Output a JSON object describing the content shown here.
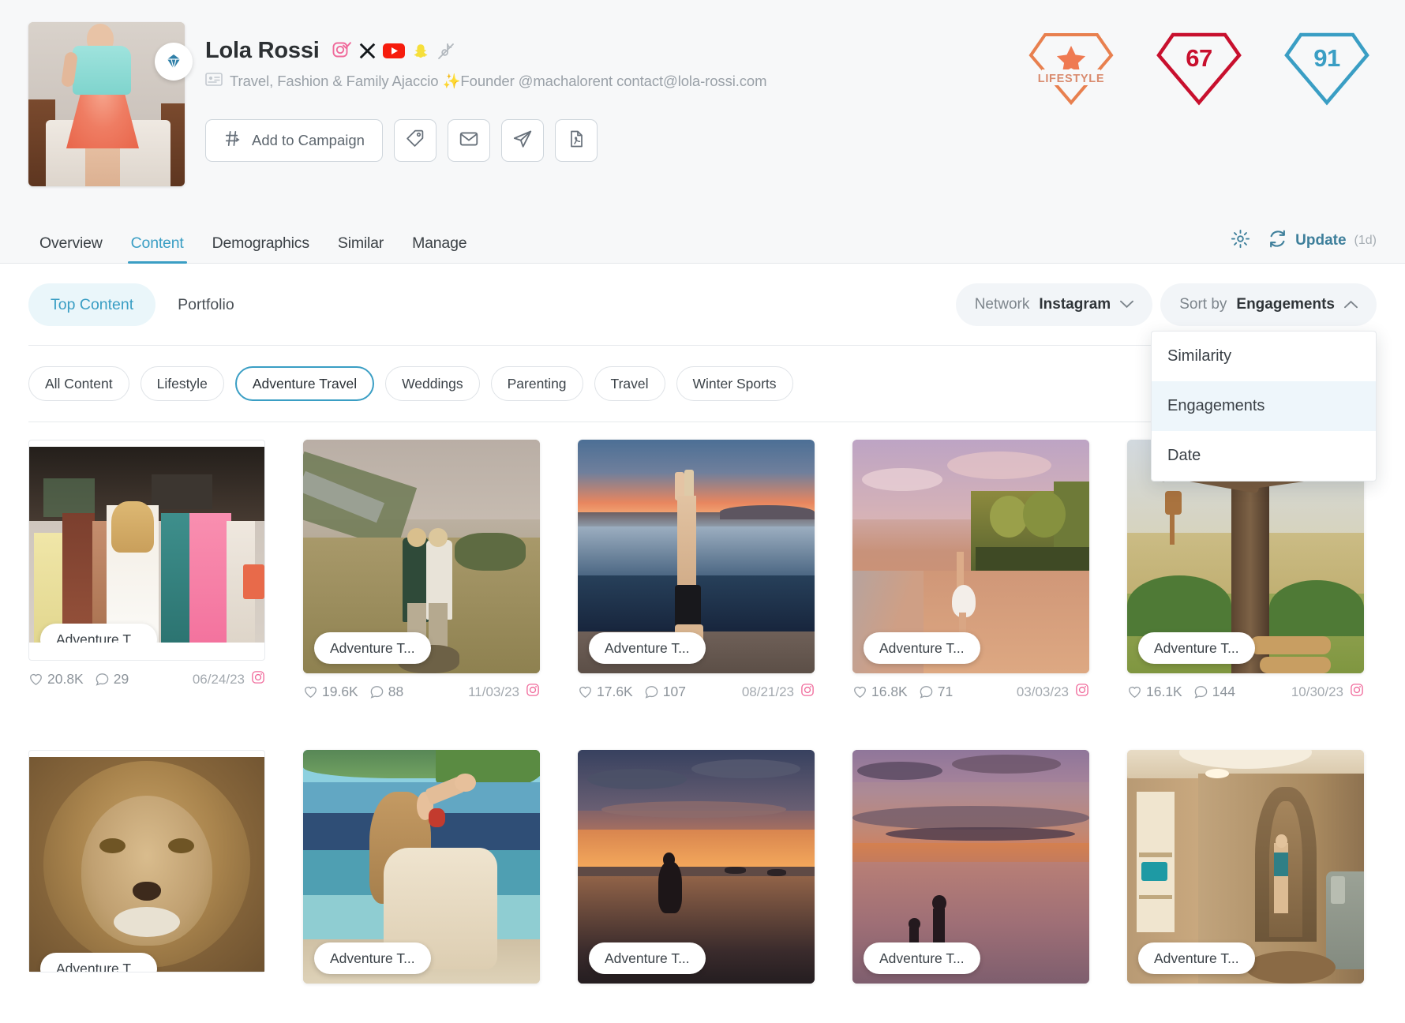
{
  "profile": {
    "name": "Lola Rossi",
    "bio": "Travel, Fashion & Family Ajaccio ✨Founder @machalorent contact@lola-rossi.com",
    "social_icons": [
      "instagram-verified-icon",
      "x-icon",
      "youtube-icon",
      "snapchat-icon",
      "tiktok-disabled-icon"
    ],
    "verified_badge": "diamond-verified-icon"
  },
  "actions": {
    "add_to_campaign": "Add to Campaign",
    "icons": [
      "tag-icon",
      "email-icon",
      "send-icon",
      "pdf-icon"
    ]
  },
  "badges": {
    "category": {
      "label": "LIFESTYLE",
      "icon": "star-icon",
      "color": "#e8804f"
    },
    "score_red": {
      "value": "67",
      "color": "#c8102e"
    },
    "score_blue": {
      "value": "91",
      "color": "#3a9ec4"
    }
  },
  "nav": {
    "tabs": [
      {
        "label": "Overview",
        "active": false
      },
      {
        "label": "Content",
        "active": true
      },
      {
        "label": "Demographics",
        "active": false
      },
      {
        "label": "Similar",
        "active": false
      },
      {
        "label": "Manage",
        "active": false
      }
    ],
    "settings_icon": "gear-icon",
    "update": {
      "icon": "refresh-icon",
      "label": "Update",
      "age": "(1d)"
    }
  },
  "content": {
    "segments": [
      {
        "label": "Top Content",
        "active": true
      },
      {
        "label": "Portfolio",
        "active": false
      }
    ],
    "network_filter": {
      "prefix": "Network",
      "value": "Instagram",
      "caret": "chevron-down-icon"
    },
    "sort_filter": {
      "prefix": "Sort by",
      "value": "Engagements",
      "caret": "chevron-up-icon"
    },
    "sort_options": [
      {
        "label": "Similarity",
        "selected": false
      },
      {
        "label": "Engagements",
        "selected": true
      },
      {
        "label": "Date",
        "selected": false
      }
    ],
    "chips": [
      {
        "label": "All Content",
        "active": false
      },
      {
        "label": "Lifestyle",
        "active": false
      },
      {
        "label": "Adventure Travel",
        "active": true
      },
      {
        "label": "Weddings",
        "active": false
      },
      {
        "label": "Parenting",
        "active": false
      },
      {
        "label": "Travel",
        "active": false
      },
      {
        "label": "Winter Sports",
        "active": false
      }
    ],
    "cards": [
      {
        "tag": "Adventure T...",
        "likes": "20.8K",
        "comments": "29",
        "date": "06/24/23",
        "network": "instagram-icon",
        "framed": true,
        "scene": "wedding"
      },
      {
        "tag": "Adventure T...",
        "likes": "19.6K",
        "comments": "88",
        "date": "11/03/23",
        "network": "instagram-icon",
        "framed": false,
        "scene": "hillside"
      },
      {
        "tag": "Adventure T...",
        "likes": "17.6K",
        "comments": "107",
        "date": "08/21/23",
        "network": "instagram-icon",
        "framed": false,
        "scene": "handstand"
      },
      {
        "tag": "Adventure T...",
        "likes": "16.8K",
        "comments": "71",
        "date": "03/03/23",
        "network": "instagram-icon",
        "framed": false,
        "scene": "palmbeach"
      },
      {
        "tag": "Adventure T...",
        "likes": "16.1K",
        "comments": "144",
        "date": "10/30/23",
        "network": "instagram-icon",
        "framed": false,
        "scene": "savanna"
      },
      {
        "tag": "Adventure T...",
        "likes": "",
        "comments": "",
        "date": "",
        "network": "",
        "framed": true,
        "scene": "lion"
      },
      {
        "tag": "Adventure T...",
        "likes": "",
        "comments": "",
        "date": "",
        "network": "",
        "framed": false,
        "scene": "seabreeze"
      },
      {
        "tag": "Adventure T...",
        "likes": "",
        "comments": "",
        "date": "",
        "network": "",
        "framed": false,
        "scene": "sunsetboat"
      },
      {
        "tag": "Adventure T...",
        "likes": "",
        "comments": "",
        "date": "",
        "network": "",
        "framed": false,
        "scene": "dusksilhouette"
      },
      {
        "tag": "Adventure T...",
        "likes": "",
        "comments": "",
        "date": "",
        "network": "",
        "framed": false,
        "scene": "spa"
      }
    ]
  }
}
